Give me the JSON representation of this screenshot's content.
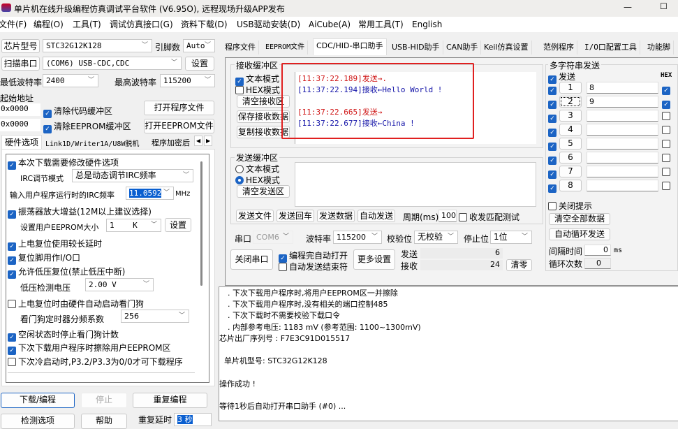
{
  "title": "单片机在线升级编程仿真调试平台软件 (V6.95O), 远程现场升级APP发布",
  "window_controls": {
    "minimize": "—",
    "maximize": "☐"
  },
  "menu": [
    "文件(F)",
    "编程(O)",
    "工具(T)",
    "调试仿真接口(G)",
    "资料下载(D)",
    "USB驱动安装(D)",
    "AiCube(A)",
    "常用工具(T)",
    "English"
  ],
  "left": {
    "chip_btn": "芯片型号",
    "chip_value": "STC32G12K128",
    "pins_label": "引脚数",
    "pins_value": "Auto",
    "scan_btn": "扫描串口",
    "port_value": "(COM6) USB-CDC,CDC",
    "settings_btn": "设置",
    "min_baud_label": "最低波特率",
    "min_baud": "2400",
    "max_baud_label": "最高波特率",
    "max_baud": "115200",
    "start_addr_label": "起始地址",
    "addr1": "0x0000",
    "clear_code": "清除代码缓冲区",
    "open_prog": "打开程序文件",
    "addr2": "0x0000",
    "clear_eeprom": "清除EEPROM缓冲区",
    "open_eeprom": "打开EEPROM文件",
    "tabs": [
      "硬件选项",
      "Link1D/Writer1A/U8W脱机",
      "程序加密后"
    ],
    "options": {
      "o1": "本次下载需要修改硬件选项",
      "irc_mode_label": "IRC调节模式",
      "irc_mode": "总是动态调节IRC频率",
      "irc_freq_label": "输入用户程序运行时的IRC频率",
      "irc_freq": "11.0592",
      "mhz": "MHz",
      "o2": "振荡器放大增益(12M以上建议选择)",
      "eeprom_size_label": "设置用户EEPROM大小",
      "eeprom_size": "1    K",
      "eeprom_set": "设置",
      "o3": "上电复位使用较长延时",
      "o4": "复位脚用作I/O口",
      "o5": "允许低压复位(禁止低压中断)",
      "lvd_label": "低压检测电压",
      "lvd": "2.00 V",
      "o6": "上电复位时由硬件自动启动看门狗",
      "wdt_label": "看门狗定时器分频系数",
      "wdt": "256",
      "o7": "空闲状态时停止看门狗计数",
      "o8": "下次下载用户程序时擦除用户EEPROM区",
      "o9": "下次冷启动时,P3.2/P3.3为0/0才可下载程序"
    },
    "download": "下载/编程",
    "stop": "停止",
    "repeat": "重复编程",
    "check": "检测选项",
    "help": "帮助",
    "delay_label": "重复延时",
    "delay": "3 秒"
  },
  "tabs": [
    "程序文件",
    "EEPROM文件",
    "CDC/HID-串口助手",
    "USB-HID助手",
    "CAN助手",
    "Keil仿真设置",
    "范例程序",
    "I/O口配置工具",
    "功能脚"
  ],
  "recv": {
    "title": "接收缓冲区",
    "text_mode": "文本模式",
    "hex_mode": "HEX模式",
    "clear": "清空接收区",
    "save": "保存接收数据",
    "copy": "复制接收数据",
    "lines": [
      {
        "text": "[11:37:22.189]发送→.",
        "color": "#d01818"
      },
      {
        "text": "[11:37:22.194]接收←Hello World !",
        "color": "#1414a8"
      },
      {
        "text": "",
        "color": "#000"
      },
      {
        "text": "[11:37:22.665]发送→",
        "color": "#d01818"
      },
      {
        "text": "[11:37:22.677]接收←China !",
        "color": "#1414a8"
      }
    ]
  },
  "send": {
    "title": "发送缓冲区",
    "text_mode": "文本模式",
    "hex_mode": "HEX模式",
    "clear": "清空发送区",
    "send_file": "发送文件",
    "send_cr": "发送回车",
    "send_data": "发送数据",
    "auto_send": "自动发送",
    "period_label": "周期(ms)",
    "period": "100",
    "match_test": "收发匹配测试"
  },
  "serial": {
    "port_label": "串口",
    "port": "COM6",
    "baud_label": "波特率",
    "baud": "115200",
    "parity_label": "校验位",
    "parity": "无校验",
    "stop_label": "停止位",
    "stop": "1位",
    "close": "关闭串口",
    "auto_open": "编程完自动打开",
    "auto_end": "自动发送结束符",
    "more": "更多设置",
    "tx_label": "发送",
    "tx": "6",
    "rx_label": "接收",
    "rx": "24",
    "clear": "清零"
  },
  "multi": {
    "title": "多字符串发送",
    "send_label": "发送",
    "hex_label": "HEX",
    "rows": [
      {
        "n": "1",
        "v": "8",
        "hex": true
      },
      {
        "n": "2",
        "v": "9",
        "hex": true
      },
      {
        "n": "3",
        "v": "",
        "hex": false
      },
      {
        "n": "4",
        "v": "",
        "hex": false
      },
      {
        "n": "5",
        "v": "",
        "hex": false
      },
      {
        "n": "6",
        "v": "",
        "hex": false
      },
      {
        "n": "7",
        "v": "",
        "hex": false
      },
      {
        "n": "8",
        "v": "",
        "hex": false
      }
    ],
    "close_tip": "关闭提示",
    "clear_all": "清空全部数据",
    "auto_loop": "自动循环发送",
    "interval_label": "间隔时间",
    "interval": "0",
    "ms": "ms",
    "loops_label": "循环次数",
    "loops": "0"
  },
  "log": [
    ". 下次下载用户程序时,将用户EEPROM区一并擦除",
    ". 下次下载用户程序时,没有相关的端口控制485",
    ". 下次下载时不需要校验下载口令",
    ". 内部参考电压: 1183 mV (参考范围: 1100~1300mV)",
    "芯片出厂序列号 : F7E3C91D015517",
    "",
    "  单片机型号: STC32G12K128",
    "",
    "操作成功 !",
    "",
    "等待1秒后自动打开串口助手 (#0) ..."
  ],
  "colors": {
    "accent": "#1c64c4",
    "highlight_box": "#e02020"
  }
}
